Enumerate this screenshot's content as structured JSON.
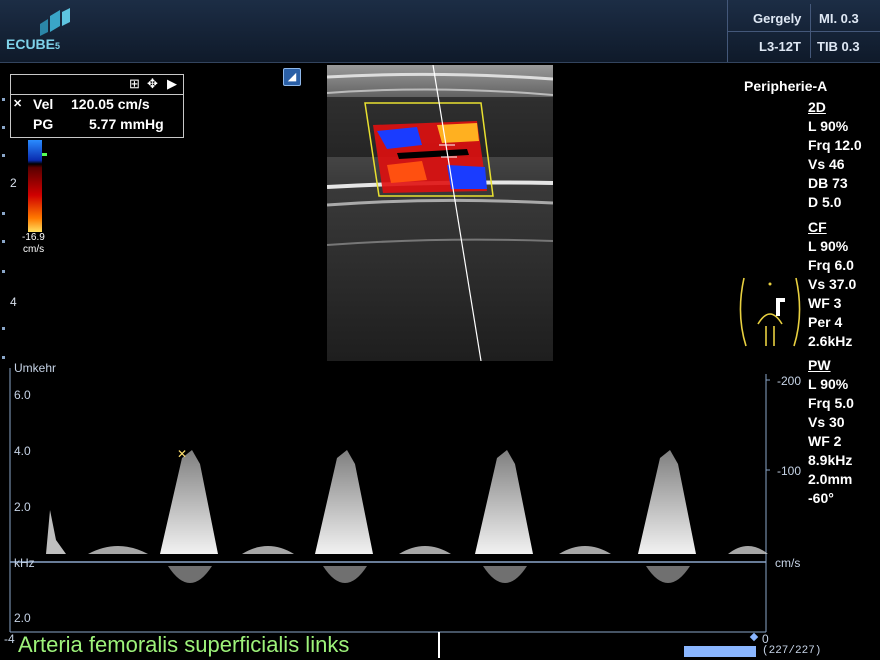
{
  "header": {
    "logo_text": "ECUBE",
    "logo_suffix": "5",
    "operator": "Gergely",
    "mi": "MI. 0.3",
    "probe": "L3-12T",
    "tib": "TIB 0.3"
  },
  "measurement": {
    "vel_label": "Vel",
    "vel_value": "120.05 cm/s",
    "pg_label": "PG",
    "pg_value": "5.77 mmHg"
  },
  "color_bar": {
    "min_label": "-16.9",
    "unit": "cm/s"
  },
  "depth_labels": [
    "2",
    "4"
  ],
  "preset": "Peripherie-A",
  "params_2d": {
    "title": "2D",
    "items": [
      "L 90%",
      "Frq 12.0",
      "Vs 46",
      "DB 73",
      "D 5.0"
    ]
  },
  "params_cf": {
    "title": "CF",
    "items": [
      "L 90%",
      "Frq 6.0",
      "Vs 37.0",
      "WF 3",
      "Per 4",
      "2.6kHz"
    ]
  },
  "params_pw": {
    "title": "PW",
    "items": [
      "L 90%",
      "Frq 5.0",
      "Vs 30",
      "WF 2",
      "8.9kHz",
      "2.0mm",
      "-60°"
    ]
  },
  "doppler": {
    "invert_label": "Umkehr",
    "left_ticks": [
      "6.0",
      "4.0",
      "2.0",
      "kHz",
      "2.0"
    ],
    "right_ticks": [
      "-200",
      "-100",
      "cm/s"
    ],
    "time_left": "-4",
    "time_right": "0"
  },
  "caption": "Arteria femoralis superficialis links",
  "progress_label": "(227/227)",
  "icons": [
    "add-box-icon",
    "move-icon",
    "play-icon",
    "cursor-marker-icon",
    "body-marker-icon"
  ]
}
